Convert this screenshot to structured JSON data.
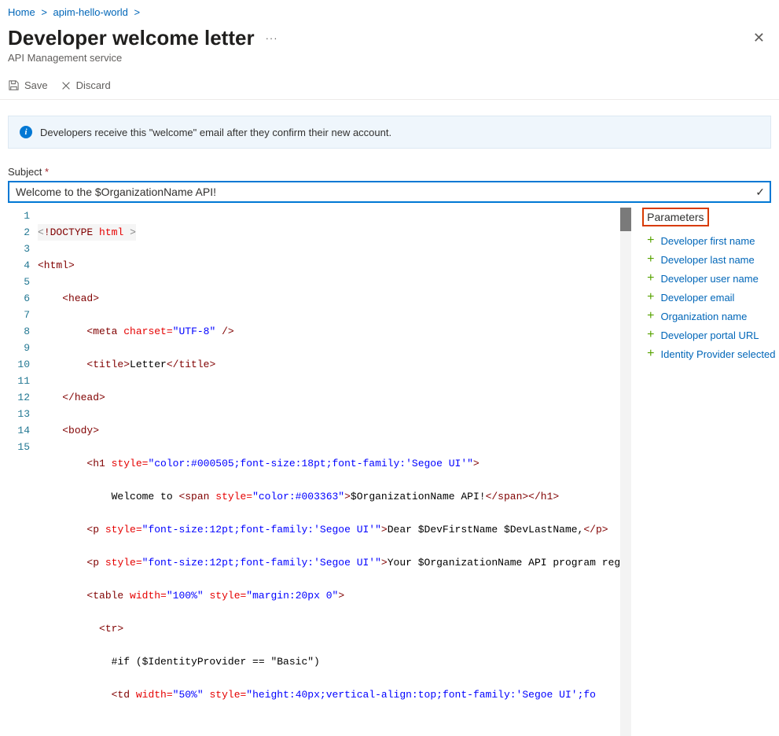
{
  "breadcrumb": {
    "home": "Home",
    "service": "apim-hello-world"
  },
  "page": {
    "title": "Developer welcome letter",
    "subtitle": "API Management service"
  },
  "toolbar": {
    "save": "Save",
    "discard": "Discard"
  },
  "info": {
    "text": "Developers receive this \"welcome\" email after they confirm their new account."
  },
  "subject": {
    "label": "Subject",
    "value": "Welcome to the $OrganizationName API!"
  },
  "editor": {
    "lines": [
      "1",
      "2",
      "3",
      "4",
      "5",
      "6",
      "7",
      "8",
      "9",
      "10",
      "11",
      "12",
      "13",
      "14",
      "15"
    ],
    "l4attr": "charset=",
    "l4val": "\"UTF-8\"",
    "l5txt": "Letter",
    "l8style": "\"color:#000505;font-size:18pt;font-family:'Segoe UI'\"",
    "l9a": "            Welcome to ",
    "l9style": "\"color:#003363\"",
    "l9b": "$OrganizationName API!",
    "l10style": "\"font-size:12pt;font-family:'Segoe UI'\"",
    "l10txt": "Dear $DevFirstName $DevLastName,",
    "l11style": "\"font-size:12pt;font-family:'Segoe UI'\"",
    "l11txt": "Your $OrganizationName API program reg",
    "l12w": "\"100%\"",
    "l12s": "\"margin:20px 0\"",
    "l14": "            #if ($IdentityProvider == \"Basic\")",
    "l15w": "\"50%\"",
    "l15s": "\"height:40px;vertical-align:top;font-family:'Segoe UI';fo"
  },
  "parameters": {
    "title": "Parameters",
    "items": [
      "Developer first name",
      "Developer last name",
      "Developer user name",
      "Developer email",
      "Organization name",
      "Developer portal URL",
      "Identity Provider selected by Organization"
    ]
  }
}
